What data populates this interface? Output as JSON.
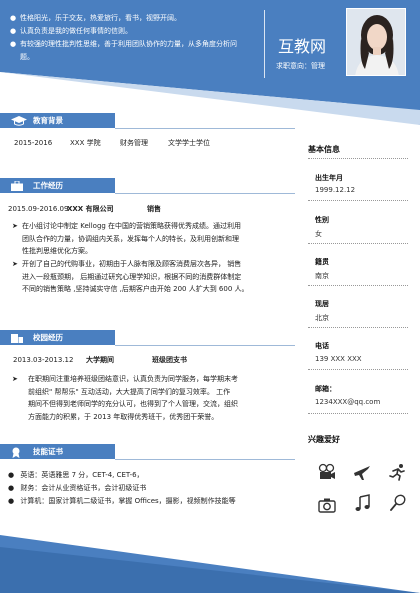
{
  "header": {
    "summary": [
      "性格阳光，乐于交友，热爱旅行，看书，视野开阔。",
      "认真负责是我的做任何事情的信则。",
      "有较强的理性批判性思维，善于利用团队协作的力量，从多角度分析问",
      "题。"
    ],
    "name": "互教网",
    "intent": "求职意向：管理"
  },
  "education": {
    "title": "教育背景",
    "years": "2015-2016",
    "school": "XXX 学院",
    "major": "财务管理",
    "degree": "文学学士学位"
  },
  "work": {
    "title": "工作经历",
    "period": "2015.09-2016.09",
    "company": "XXX 有限公司",
    "role": "销售",
    "items": [
      [
        "在小组讨论中制定 Kellogg 在中国的营销策略获得优秀成绩。通过利用",
        "团队合作的力量，协调组内关系，发挥每个人的特长，及利用创新和理",
        "性批判思维优化方案。"
      ],
      [
        "开创了自己的代购事业，初期由于人脉有限及顾客消费层次各异， 销售",
        "进入一段瓶颈期， 后期通过研究心理学知识，根据不同的消费群体制定",
        "不同的销售策略 ,坚持诚实守信 ,后期客户由开始 200 人扩大到 600 人。"
      ]
    ]
  },
  "campus": {
    "title": "校园经历",
    "period": "2013.03-2013.12",
    "org": "大学期间",
    "role": "班级团支书",
    "items": [
      [
        "在职期间注重培养班级团结意识，认真负责为同学服务，每学期末考",
        "前组织\" 帮帮乐\" 互动活动，大大提高了同学们的复习效率。 工作",
        "期间不但得到老师同学的充分认可，也得到了个人管理，交流，组织",
        "方面能力的积累，于 2013 年取得优秀班干，优秀团干荣誉。"
      ]
    ]
  },
  "certs": {
    "title": "技能证书",
    "rows": [
      {
        "label": "英语",
        "value": "：英语雅思 7 分，CET-4, CET-6，"
      },
      {
        "label": "财务",
        "value": "：会计从业资格证书，会计初级证书"
      },
      {
        "label": "计算机",
        "value": "：国家计算机二级证书，掌握 Offices，摄影，视频制作技能等"
      }
    ]
  },
  "basic": {
    "title": "基本信息",
    "fields": [
      {
        "label": "出生年月",
        "value": "1999.12.12"
      },
      {
        "label": "性别",
        "value": "女"
      },
      {
        "label": "籍贯",
        "value": "南京"
      },
      {
        "label": "现居",
        "value": "北京"
      },
      {
        "label": "电话",
        "value": "139 XXX XXX"
      },
      {
        "label": "邮箱：",
        "value": "1234XXX@qq.com"
      }
    ]
  },
  "hobbies": {
    "title": "兴趣爱好",
    "icons": [
      "camera-reel-icon",
      "airplane-icon",
      "running-icon",
      "photo-camera-icon",
      "music-note-icon",
      "badminton-icon"
    ]
  },
  "colors": {
    "accent": "#4a7fc0",
    "accent_dark": "#3b6fae",
    "light": "#c9daee"
  }
}
